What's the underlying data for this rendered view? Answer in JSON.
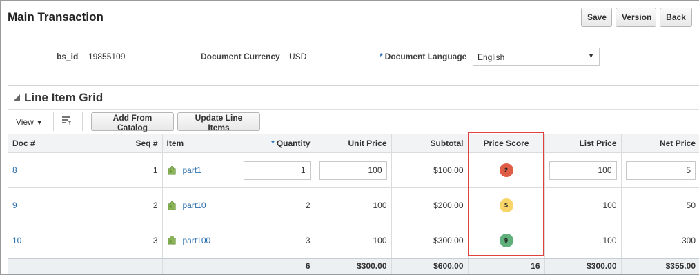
{
  "page": {
    "title": "Main Transaction"
  },
  "header_buttons": {
    "save": "Save",
    "version": "Version",
    "back": "Back"
  },
  "fields": {
    "bs_id": {
      "label": "bs_id",
      "value": "19855109"
    },
    "currency": {
      "label": "Document Currency",
      "value": "USD"
    },
    "language": {
      "label": "Document Language",
      "required": "*",
      "value": "English"
    }
  },
  "grid": {
    "title": "Line Item Grid",
    "toolbar": {
      "view": "View",
      "add_from_catalog": "Add From Catalog",
      "update_line_items": "Update Line Items"
    },
    "columns": {
      "doc": "Doc #",
      "seq": "Seq #",
      "item": "Item",
      "quantity_required": "*",
      "quantity": "Quantity",
      "unit_price": "Unit Price",
      "subtotal": "Subtotal",
      "price_score": "Price Score",
      "list_price": "List Price",
      "net_price": "Net Price"
    },
    "rows": [
      {
        "doc": "8",
        "seq": "1",
        "item": "part1",
        "quantity": "1",
        "unit_price": "100",
        "subtotal": "$100.00",
        "price_score": "2",
        "score_color": "#e05d45",
        "list_price": "100",
        "net_price": "5"
      },
      {
        "doc": "9",
        "seq": "2",
        "item": "part10",
        "quantity": "2",
        "unit_price": "100",
        "subtotal": "$200.00",
        "price_score": "5",
        "score_color": "#f7d569",
        "list_price": "100",
        "net_price": "50"
      },
      {
        "doc": "10",
        "seq": "3",
        "item": "part100",
        "quantity": "3",
        "unit_price": "100",
        "subtotal": "$300.00",
        "price_score": "9",
        "score_color": "#5fb07a",
        "list_price": "100",
        "net_price": "300"
      }
    ],
    "totals": {
      "quantity": "6",
      "unit_price": "$300.00",
      "subtotal": "$600.00",
      "price_score": "16",
      "list_price": "$300.00",
      "net_price": "$355.00"
    }
  },
  "colors": {
    "link": "#2a6ead",
    "highlight": "#e0413e",
    "required": "#2b71b8"
  },
  "icons": {
    "item": "puzzle-piece-icon",
    "toolbar": "filter-list-icon",
    "view_menu": "caret-down-icon",
    "section_toggle": "collapse-triangle-icon",
    "dropdown": "dropdown-arrow-icon"
  }
}
